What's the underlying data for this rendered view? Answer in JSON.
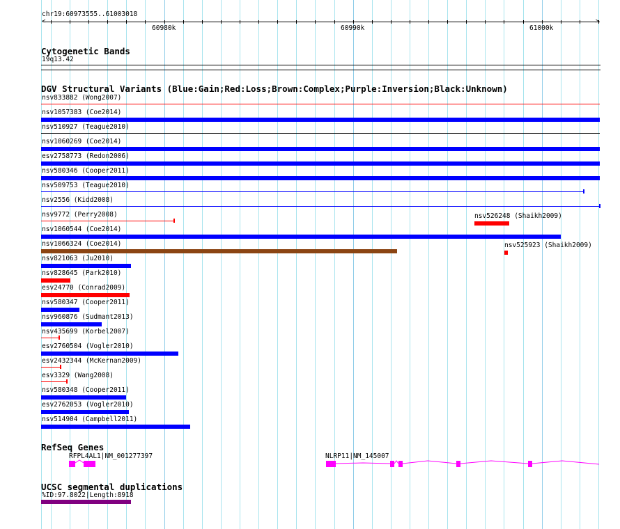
{
  "ruler": {
    "location": "chr19:60973555..61003018",
    "ticks": [
      "60980k",
      "60990k",
      "61000k"
    ]
  },
  "cytoband": {
    "title": "Cytogenetic Bands",
    "band": "19q13.42"
  },
  "dgv": {
    "title": "DGV Structural Variants (Blue:Gain;Red:Loss;Brown:Complex;Purple:Inversion;Black:Unknown)",
    "colors": {
      "gain": "#0000ff",
      "loss": "#ff0000",
      "complex": "#8b4513",
      "unknown": "#000000",
      "inversion": "#800080"
    },
    "variants": [
      {
        "label": "nsv833882 (Wong2007)",
        "type": "loss"
      },
      {
        "label": "nsv1057383 (Coe2014)",
        "type": "gain"
      },
      {
        "label": "nsv510927 (Teague2010)",
        "type": "unknown"
      },
      {
        "label": "nsv1060269 (Coe2014)",
        "type": "gain"
      },
      {
        "label": "esv2758773 (Redon2006)",
        "type": "gain"
      },
      {
        "label": "nsv580346 (Cooper2011)",
        "type": "gain"
      },
      {
        "label": "nsv509753 (Teague2010)",
        "type": "gain"
      },
      {
        "label": "nsv2556 (Kidd2008)",
        "type": "gain"
      },
      {
        "label": "nsv9772 (Perry2008)",
        "type": "loss"
      },
      {
        "label": "nsv526248 (Shaikh2009)",
        "type": "loss"
      },
      {
        "label": "nsv1060544 (Coe2014)",
        "type": "gain"
      },
      {
        "label": "nsv1066324 (Coe2014)",
        "type": "complex"
      },
      {
        "label": "nsv525923 (Shaikh2009)",
        "type": "loss"
      },
      {
        "label": "nsv821063 (Ju2010)",
        "type": "gain"
      },
      {
        "label": "nsv828645 (Park2010)",
        "type": "loss"
      },
      {
        "label": "esv24770 (Conrad2009)",
        "type": "loss"
      },
      {
        "label": "nsv580347 (Cooper2011)",
        "type": "gain"
      },
      {
        "label": "nsv960876 (Sudmant2013)",
        "type": "gain"
      },
      {
        "label": "nsv435699 (Korbel2007)",
        "type": "loss"
      },
      {
        "label": "esv2760504 (Vogler2010)",
        "type": "gain"
      },
      {
        "label": "esv2432344 (McKernan2009)",
        "type": "loss"
      },
      {
        "label": "esv3329 (Wang2008)",
        "type": "loss"
      },
      {
        "label": "nsv580348 (Cooper2011)",
        "type": "gain"
      },
      {
        "label": "esv2762053 (Vogler2010)",
        "type": "gain"
      },
      {
        "label": "nsv514904 (Campbell2011)",
        "type": "gain"
      }
    ]
  },
  "refseq": {
    "title": "RefSeq Genes",
    "color": "#ff00ff",
    "genes": [
      "RFPL4AL1|NM_001277397",
      "NLRP11|NM_145007"
    ]
  },
  "segdup": {
    "title": "UCSC segmental duplications",
    "color": "#800080",
    "label": "%ID:97.8022|Length:8918"
  }
}
